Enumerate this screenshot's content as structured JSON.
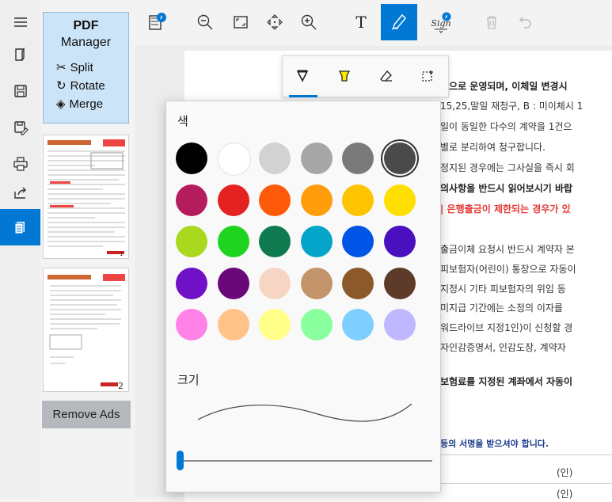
{
  "rail": {
    "items": [
      {
        "name": "menu-icon",
        "active": false
      },
      {
        "name": "open-file-icon",
        "active": false
      },
      {
        "name": "save-icon",
        "active": false
      },
      {
        "name": "save-as-icon",
        "active": false
      },
      {
        "name": "print-icon",
        "active": false
      },
      {
        "name": "share-icon",
        "active": false
      },
      {
        "name": "pages-icon",
        "active": true
      }
    ]
  },
  "pdf_manager": {
    "title_bold": "PDF",
    "title": "Manager",
    "split": "Split",
    "rotate": "Rotate",
    "merge": "Merge"
  },
  "thumbnails": [
    {
      "page_label": "1"
    },
    {
      "page_label": "2"
    }
  ],
  "remove_ads": "Remove Ads",
  "toolbar": {
    "text_tool": "T",
    "sign_label": "Sign"
  },
  "pen_tools": [
    "pen-icon",
    "highlighter-icon",
    "eraser-icon",
    "lasso-select-icon"
  ],
  "palette": {
    "color_label": "색",
    "size_label": "크기",
    "colors": [
      "#000000",
      "#ffffff",
      "#d2d2d2",
      "#a6a6a6",
      "#7a7a7a",
      "#4a4a4a",
      "#b51c5e",
      "#e52222",
      "#ff5a0a",
      "#ff9e0a",
      "#ffc400",
      "#ffdf00",
      "#a8d91f",
      "#1fd41f",
      "#0f7a50",
      "#05a5c9",
      "#0055e6",
      "#4a0fbf",
      "#7010c7",
      "#6a087a",
      "#f7d5c4",
      "#c4956b",
      "#8c5a2a",
      "#5e3b28",
      "#ff82e8",
      "#ffc38a",
      "#ffff8a",
      "#8aff9e",
      "#7ecfff",
      "#bdb8ff"
    ],
    "selected_index": 5,
    "size_value": 0
  },
  "document_lines": [
    {
      "text": "식으로 운영되며, 이체일 변경시",
      "style": "b"
    },
    {
      "text": "15,25,말일 재청구, B : 미이체시 1",
      "style": "n"
    },
    {
      "text": "일이 동일한 다수의 계약을 1건으",
      "style": "n"
    },
    {
      "text": "별로 분리하여 청구합니다.",
      "style": "n"
    },
    {
      "text": "정지된 경우에는 그사실을 즉시 회",
      "style": "n"
    },
    {
      "text": "의사항을 반드시 읽어보시기 바랍",
      "style": "b"
    },
    {
      "text": "| 은행출금이 제한되는 경우가 있",
      "style": "r"
    },
    {
      "text": "출금이체 요청시 반드시 계약자 본",
      "style": "n"
    },
    {
      "text": "피보험자(어린이) 통장으로 자동이",
      "style": "n"
    },
    {
      "text": "지정시 기타 피보험자의 위임 동",
      "style": "n"
    },
    {
      "text": "미지급 기간에는 소정의 이자를",
      "style": "n"
    },
    {
      "text": "워드라이브 지정1인)이 신청할 경",
      "style": "n"
    },
    {
      "text": "자인감증명서, 인감도장, 계약자",
      "style": "n"
    },
    {
      "text": "보험료를 지정된 계좌에서 자동이",
      "style": "b"
    },
    {
      "text": "등의 서명을 받으셔야 합니다.",
      "style": "b"
    },
    {
      "text": "(인)",
      "style": "n"
    },
    {
      "text": "(인)",
      "style": "n"
    }
  ]
}
